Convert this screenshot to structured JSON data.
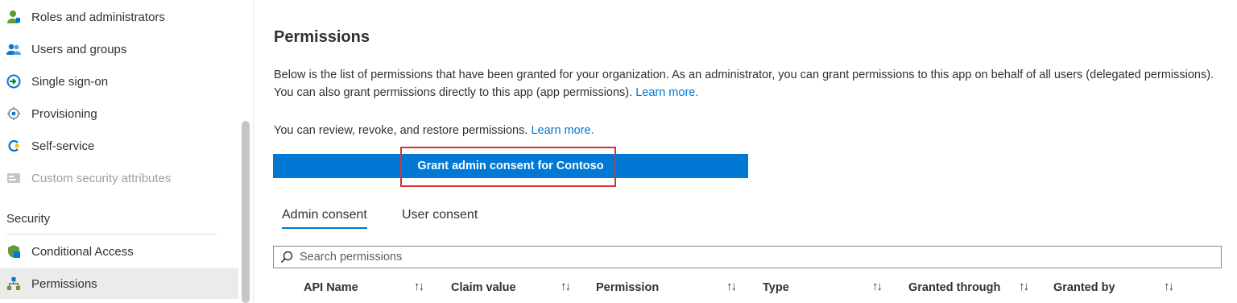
{
  "sidebar": {
    "items": [
      {
        "label": "Roles and administrators",
        "icon": "roles-admin-icon"
      },
      {
        "label": "Users and groups",
        "icon": "users-groups-icon"
      },
      {
        "label": "Single sign-on",
        "icon": "sso-icon"
      },
      {
        "label": "Provisioning",
        "icon": "provisioning-icon"
      },
      {
        "label": "Self-service",
        "icon": "self-service-icon"
      },
      {
        "label": "Custom security attributes",
        "icon": "custom-attributes-icon"
      }
    ],
    "security_header": "Security",
    "security_items": [
      {
        "label": "Conditional Access",
        "icon": "conditional-access-icon"
      },
      {
        "label": "Permissions",
        "icon": "permissions-icon"
      }
    ]
  },
  "main": {
    "title": "Permissions",
    "description": "Below is the list of permissions that have been granted for your organization. As an administrator, you can grant permissions to this app on behalf of all users (delegated permissions). You can also grant permissions directly to this app (app permissions).",
    "learn_more_1": "Learn more.",
    "review_text": "You can review, revoke, and restore permissions.",
    "learn_more_2": "Learn more.",
    "grant_button": "Grant admin consent for Contoso",
    "tabs": [
      {
        "label": "Admin consent",
        "active": true
      },
      {
        "label": "User consent",
        "active": false
      }
    ],
    "search_placeholder": "Search permissions",
    "columns": [
      "API Name",
      "Claim value",
      "Permission",
      "Type",
      "Granted through",
      "Granted by"
    ],
    "sort_glyph": "↑↓"
  },
  "colors": {
    "accent": "#0078d4",
    "highlight": "#d13438"
  }
}
